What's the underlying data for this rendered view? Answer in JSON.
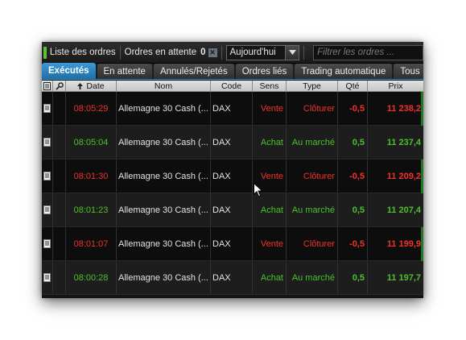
{
  "toolbar": {
    "list_label": "Liste des ordres",
    "pending_label": "Ordres en attente",
    "pending_count": "0",
    "period_value": "Aujourd'hui",
    "filter_placeholder": "Filtrer les ordres ..."
  },
  "tabs": [
    {
      "label": "Exécutés",
      "active": true
    },
    {
      "label": "En attente"
    },
    {
      "label": "Annulés/Rejetés"
    },
    {
      "label": "Ordres liés"
    },
    {
      "label": "Trading automatique"
    },
    {
      "label": "Tous"
    }
  ],
  "columns": {
    "date": "Date",
    "name": "Nom",
    "code": "Code",
    "side": "Sens",
    "type": "Type",
    "qty": "Qté",
    "price": "Prix"
  },
  "orders": [
    {
      "time": "08:05:29",
      "name": "Allemagne 30 Cash (...",
      "code": "DAX",
      "side": "Vente",
      "type": "Clôturer",
      "qty": "-0,5",
      "price": "11 238,2",
      "color": "red"
    },
    {
      "time": "08:05:04",
      "name": "Allemagne 30 Cash (...",
      "code": "DAX",
      "side": "Achat",
      "type": "Au marché",
      "qty": "0,5",
      "price": "11 237,4",
      "color": "green"
    },
    {
      "time": "08:01:30",
      "name": "Allemagne 30 Cash (...",
      "code": "DAX",
      "side": "Vente",
      "type": "Clôturer",
      "qty": "-0,5",
      "price": "11 209,2",
      "color": "red"
    },
    {
      "time": "08:01:23",
      "name": "Allemagne 30 Cash (...",
      "code": "DAX",
      "side": "Achat",
      "type": "Au marché",
      "qty": "0,5",
      "price": "11 207,4",
      "color": "green"
    },
    {
      "time": "08:01:07",
      "name": "Allemagne 30 Cash (...",
      "code": "DAX",
      "side": "Vente",
      "type": "Clôturer",
      "qty": "-0,5",
      "price": "11 199,9",
      "color": "red"
    },
    {
      "time": "08:00:28",
      "name": "Allemagne 30 Cash (...",
      "code": "DAX",
      "side": "Achat",
      "type": "Au marché",
      "qty": "0,5",
      "price": "11 197,7",
      "color": "green"
    }
  ],
  "colors": {
    "sell": "#f0322c",
    "buy": "#4cc02a",
    "accent": "#2d8acb"
  }
}
